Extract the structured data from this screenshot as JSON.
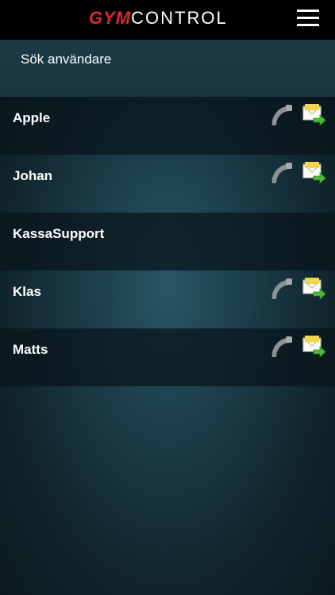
{
  "header": {
    "logo_part1": "GYM",
    "logo_part2": "CONTROL"
  },
  "search": {
    "placeholder": "Sök användare"
  },
  "users": [
    {
      "name": "Apple",
      "has_contact": true
    },
    {
      "name": "Johan",
      "has_contact": true
    },
    {
      "name": "KassaSupport",
      "has_contact": false
    },
    {
      "name": "Klas",
      "has_contact": true
    },
    {
      "name": "Matts",
      "has_contact": true
    }
  ],
  "icons": {
    "menu": "hamburger-menu-icon",
    "phone": "phone-icon",
    "mail": "mail-send-icon"
  },
  "colors": {
    "brand_red": "#d92b2b",
    "header_bg": "#000000",
    "text": "#ffffff"
  }
}
